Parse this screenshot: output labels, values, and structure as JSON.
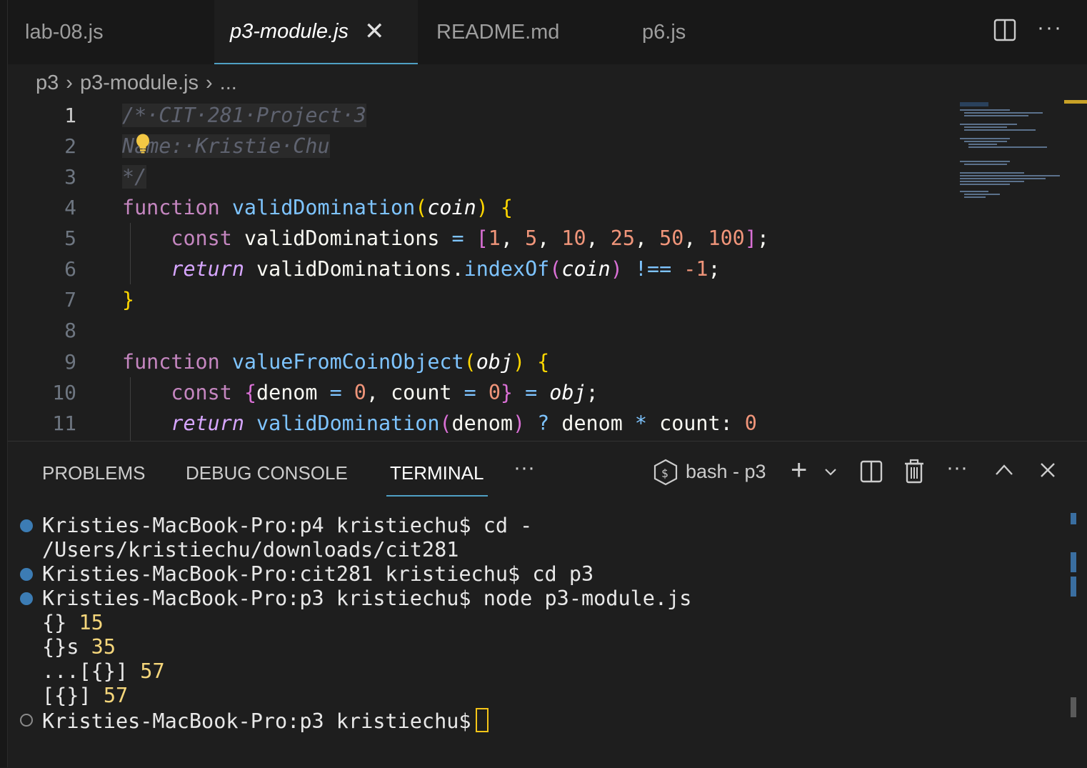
{
  "tabs": [
    {
      "label": "lab-08.js",
      "active": false
    },
    {
      "label": "p3-module.js",
      "active": true
    },
    {
      "label": "README.md",
      "active": false
    },
    {
      "label": "p6.js",
      "active": false
    }
  ],
  "breadcrumb": {
    "folder": "p3",
    "file": "p3-module.js",
    "more": "..."
  },
  "editor": {
    "line_numbers": [
      "1",
      "2",
      "3",
      "4",
      "5",
      "6",
      "7",
      "8",
      "9",
      "10",
      "11"
    ],
    "comment": {
      "l1": "/*·CIT·281·Project·3",
      "l2": "Name:·Kristie·Chu",
      "l3": "*/"
    },
    "kw_function": "function",
    "kw_const": "const",
    "kw_return": "return",
    "fn1": {
      "name": "validDomination",
      "param": "coin"
    },
    "l5": {
      "var": "validDominations",
      "values": [
        "1",
        "5",
        "10",
        "25",
        "50",
        "100"
      ]
    },
    "l6": {
      "obj": "validDominations",
      "method": "indexOf",
      "arg": "coin",
      "op": "!==",
      "neg": "-1"
    },
    "fn2": {
      "name": "valueFromCoinObject",
      "param": "obj"
    },
    "l10": {
      "k1": "denom",
      "v1": "0",
      "k2": "count",
      "v2": "0",
      "src": "obj"
    },
    "l11": {
      "call": "validDomination",
      "arg": "denom",
      "a": "denom",
      "b": "count",
      "zero": "0"
    }
  },
  "panel": {
    "tabs": [
      "PROBLEMS",
      "DEBUG CONSOLE",
      "TERMINAL"
    ],
    "active_tab": "TERMINAL",
    "shell_label": "bash - p3"
  },
  "terminal": {
    "lines": [
      {
        "dot": "blue",
        "text": "Kristies-MacBook-Pro:p4 kristiechu$ cd -"
      },
      {
        "dot": "",
        "text": "/Users/kristiechu/downloads/cit281"
      },
      {
        "dot": "blue",
        "text": "Kristies-MacBook-Pro:cit281 kristiechu$ cd p3"
      },
      {
        "dot": "blue",
        "text": "Kristies-MacBook-Pro:p3 kristiechu$ node p3-module.js"
      }
    ],
    "output": [
      {
        "label": "{}",
        "value": "15"
      },
      {
        "label": "{}s",
        "value": "35"
      },
      {
        "label": "...[{}]",
        "value": "57"
      },
      {
        "label": "[{}]",
        "value": "57"
      }
    ],
    "prompt": "Kristies-MacBook-Pro:p3 kristiechu$"
  },
  "colors": {
    "accent": "#4fa0c4",
    "background": "#1e1e1e",
    "prompt_dot": "#3c7cb4",
    "number": "#f5d67b"
  }
}
